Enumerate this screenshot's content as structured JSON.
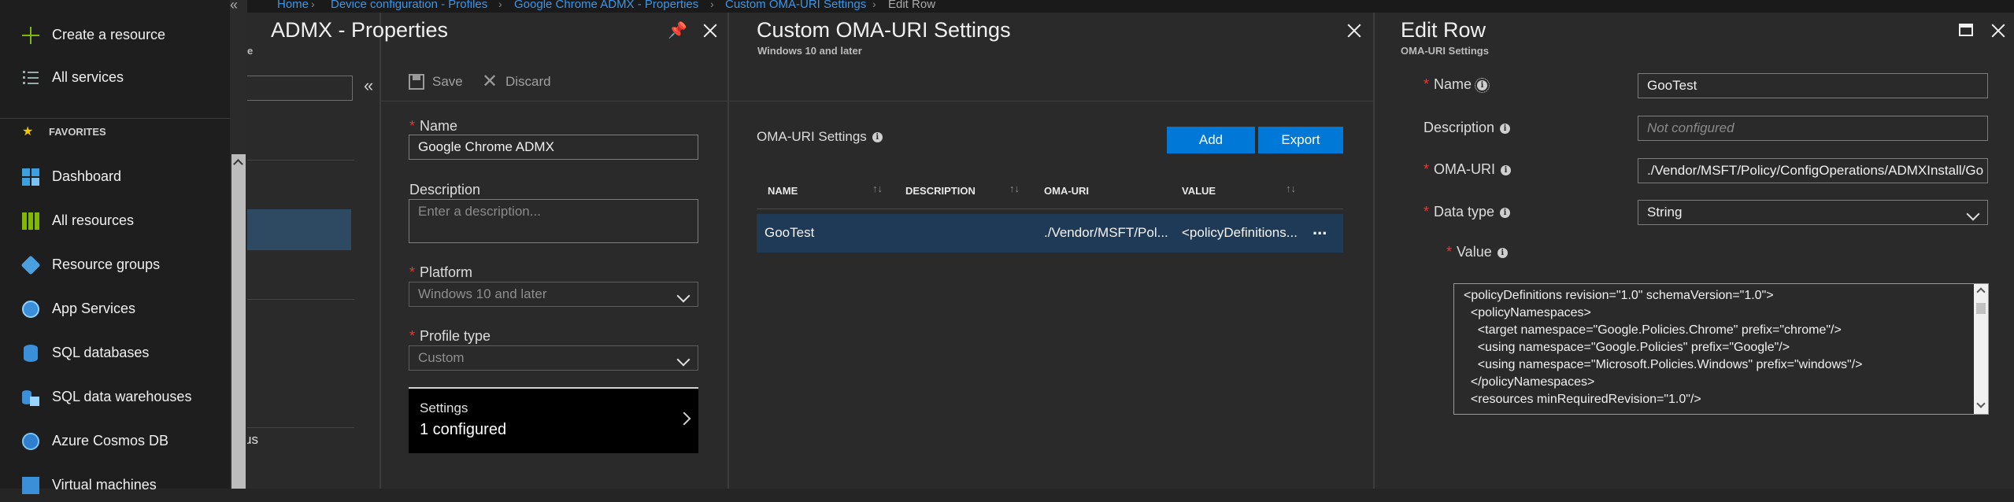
{
  "breadcrumb": {
    "items": [
      "Home",
      "Device configuration - Profiles",
      "Google Chrome ADMX - Properties",
      "Custom OMA-URI Settings"
    ],
    "current": "Edit Row"
  },
  "sidebar": {
    "create": "Create a resource",
    "all_services": "All services",
    "favorites_header": "FAVORITES",
    "items": [
      {
        "label": "Dashboard",
        "icon": "dashboard-icon"
      },
      {
        "label": "All resources",
        "icon": "grid-icon"
      },
      {
        "label": "Resource groups",
        "icon": "cube-icon"
      },
      {
        "label": "App Services",
        "icon": "globe-icon"
      },
      {
        "label": "SQL databases",
        "icon": "database-icon"
      },
      {
        "label": "SQL data warehouses",
        "icon": "data-warehouse-icon"
      },
      {
        "label": "Azure Cosmos DB",
        "icon": "cosmos-icon"
      },
      {
        "label": "Virtual machines",
        "icon": "vm-icon"
      }
    ],
    "peek_text": "us"
  },
  "properties": {
    "title_fragment": "ADMX - Properties",
    "sub_fragment": "e",
    "toolbar": {
      "save": "Save",
      "discard": "Discard"
    },
    "name_label": "Name",
    "name_value": "Google Chrome ADMX",
    "description_label": "Description",
    "description_placeholder": "Enter a description...",
    "platform_label": "Platform",
    "platform_value": "Windows 10 and later",
    "profile_type_label": "Profile type",
    "profile_type_value": "Custom",
    "settings_title": "Settings",
    "settings_value": "1 configured"
  },
  "oma": {
    "title": "Custom OMA-URI Settings",
    "subtitle": "Windows 10 and later",
    "section_label": "OMA-URI Settings",
    "add_button": "Add",
    "export_button": "Export",
    "columns": [
      "NAME",
      "DESCRIPTION",
      "OMA-URI",
      "VALUE"
    ],
    "row": {
      "name": "GooTest",
      "description": "",
      "oma_uri": "./Vendor/MSFT/Pol...",
      "value": "<policyDefinitions..."
    },
    "more": "..."
  },
  "edit_row": {
    "title": "Edit Row",
    "subtitle": "OMA-URI Settings",
    "name_label": "Name",
    "name_value": "GooTest",
    "description_label": "Description",
    "description_placeholder": "Not configured",
    "oma_uri_label": "OMA-URI",
    "oma_uri_value": "./Vendor/MSFT/Policy/ConfigOperations/ADMXInstall/Go",
    "data_type_label": "Data type",
    "data_type_value": "String",
    "value_label": "Value",
    "value_lines": [
      "<policyDefinitions revision=\"1.0\" schemaVersion=\"1.0\">",
      "  <policyNamespaces>",
      "    <target namespace=\"Google.Policies.Chrome\" prefix=\"chrome\"/>",
      "    <using namespace=\"Google.Policies\" prefix=\"Google\"/>",
      "    <using namespace=\"Microsoft.Policies.Windows\" prefix=\"windows\"/>",
      "  </policyNamespaces>",
      "  <resources minRequiredRevision=\"1.0\"/>"
    ]
  },
  "colors": {
    "accent": "#0078d7",
    "link": "#3e95e6",
    "required": "#e5393a",
    "background": "#2a2a2a"
  }
}
